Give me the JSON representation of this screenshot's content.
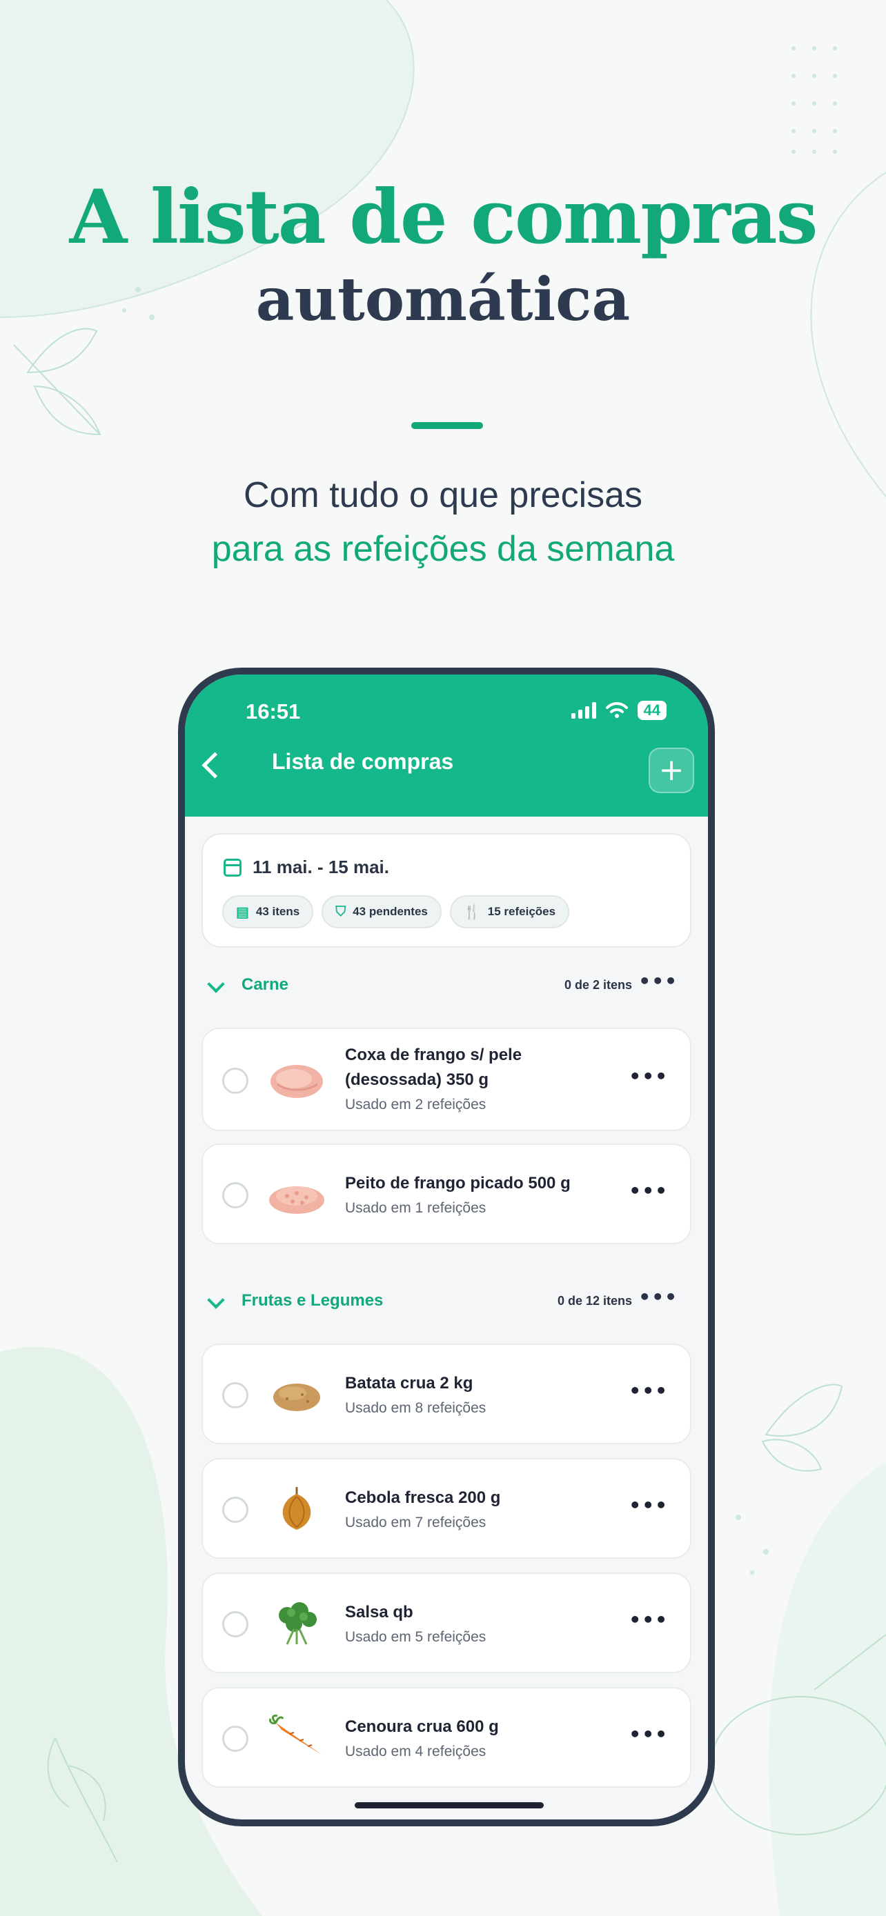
{
  "hero": {
    "title_line1": "A lista de compras",
    "title_line2": "automática",
    "subtitle_line1": "Com tudo o que precisas",
    "subtitle_line2": "para as refeições da semana"
  },
  "colors": {
    "accent": "#15b88a",
    "title_dark": "#2d3a4f",
    "phone_frame": "#2e3a4e"
  },
  "status_bar": {
    "time": "16:51",
    "battery": "44"
  },
  "nav": {
    "title": "Lista de compras",
    "add_label": "+"
  },
  "summary": {
    "date_range": "11 mai. - 15 mai.",
    "chips": [
      {
        "icon": "list-icon",
        "label": "43 itens"
      },
      {
        "icon": "basket-icon",
        "label": "43 pendentes"
      },
      {
        "icon": "cutlery-icon",
        "label": "15 refeições"
      }
    ]
  },
  "sections": [
    {
      "name": "Carne",
      "count": "0 de 2 itens",
      "items": [
        {
          "name_line1": "Coxa de frango s/ pele",
          "name_line2": "(desossada) 350 g",
          "usage": "Usado em 2 refeições",
          "icon": "chicken-thigh-image"
        },
        {
          "name_line1": "Peito de frango picado 500 g",
          "usage": "Usado em 1 refeições",
          "icon": "minced-chicken-image"
        }
      ]
    },
    {
      "name": "Frutas e Legumes",
      "count": "0 de 12 itens",
      "items": [
        {
          "name_line1": "Batata crua 2 kg",
          "usage": "Usado em 8 refeições",
          "icon": "potato-image"
        },
        {
          "name_line1": "Cebola fresca 200 g",
          "usage": "Usado em 7 refeições",
          "icon": "onion-image"
        },
        {
          "name_line1": "Salsa  qb",
          "usage": "Usado em 5 refeições",
          "icon": "parsley-image"
        },
        {
          "name_line1": "Cenoura crua 600 g",
          "usage": "Usado em 4 refeições",
          "icon": "carrot-image"
        }
      ]
    }
  ],
  "more_glyph": "•••"
}
